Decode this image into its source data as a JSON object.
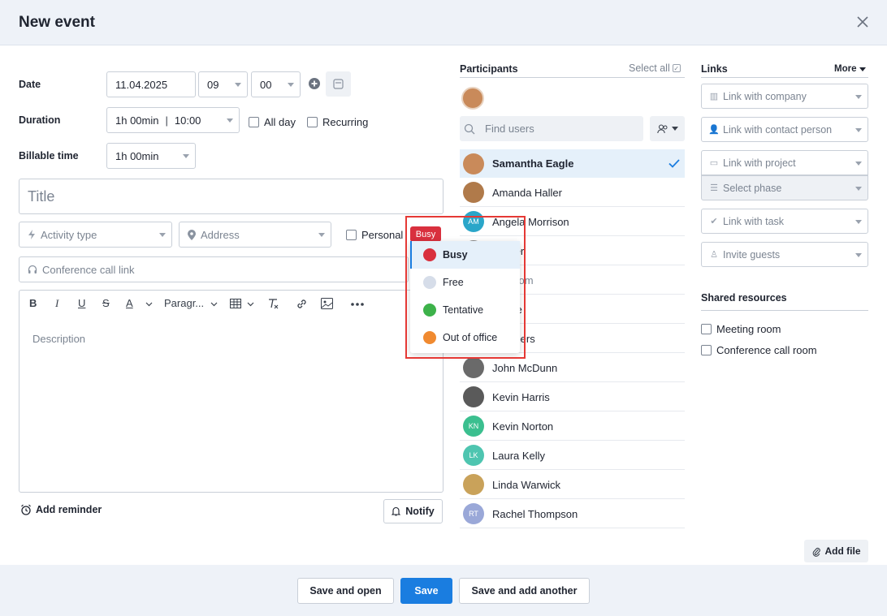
{
  "header": {
    "title": "New event"
  },
  "form": {
    "date_label": "Date",
    "date_value": "11.04.2025",
    "hour_value": "09",
    "minute_value": "00",
    "duration_label": "Duration",
    "duration_value": "1h 00min",
    "duration_end": "10:00",
    "all_day_label": "All day",
    "recurring_label": "Recurring",
    "billable_label": "Billable time",
    "billable_value": "1h 00min",
    "title_placeholder": "Title",
    "activity_type_placeholder": "Activity type",
    "address_placeholder": "Address",
    "personal_label": "Personal",
    "busy_badge": "Busy",
    "conference_placeholder": "Conference call link",
    "paragraph_label": "Paragr...",
    "description_placeholder": "Description",
    "add_reminder_label": "Add reminder",
    "notify_label": "Notify"
  },
  "availability_dropdown": {
    "items": [
      {
        "label": "Busy",
        "color": "#d9303e",
        "selected": true
      },
      {
        "label": "Free",
        "color": "#d6dde9",
        "selected": false
      },
      {
        "label": "Tentative",
        "color": "#3db24a",
        "selected": false
      },
      {
        "label": "Out of office",
        "color": "#f08a30",
        "selected": false
      }
    ]
  },
  "participants": {
    "title": "Participants",
    "select_all_label": "Select all",
    "search_placeholder": "Find users",
    "list": [
      {
        "name": "Samantha Eagle",
        "initials": "",
        "color": "#c98a5a",
        "selected": true
      },
      {
        "name": "Amanda Haller",
        "initials": "",
        "color": "#b07a4a",
        "selected": false
      },
      {
        "name": "Angela Morrison",
        "initials": "AM",
        "color": "#2aa6c9",
        "selected": false
      },
      {
        "name": "Tucker",
        "initials": "",
        "color": "#8a8a8a",
        "selected": false
      },
      {
        "name": "id Bloom",
        "initials": "",
        "color": "#b0b6c0",
        "selected": false
      },
      {
        "name": "Moore",
        "initials": "",
        "color": "#8a8a8a",
        "selected": false
      },
      {
        "name": "Numbers",
        "initials": "",
        "color": "#8a8a8a",
        "selected": false
      },
      {
        "name": "John McDunn",
        "initials": "",
        "color": "#6a6a6a",
        "selected": false
      },
      {
        "name": "Kevin Harris",
        "initials": "",
        "color": "#5a5a5a",
        "selected": false
      },
      {
        "name": "Kevin Norton",
        "initials": "KN",
        "color": "#3bbf8f",
        "selected": false
      },
      {
        "name": "Laura Kelly",
        "initials": "LK",
        "color": "#4ec5b0",
        "selected": false
      },
      {
        "name": "Linda Warwick",
        "initials": "",
        "color": "#c9a25a",
        "selected": false
      },
      {
        "name": "Rachel Thompson",
        "initials": "RT",
        "color": "#9aa8d8",
        "selected": false
      }
    ]
  },
  "links": {
    "title": "Links",
    "more_label": "More",
    "items": [
      {
        "label": "Link with company",
        "icon": "building-icon"
      },
      {
        "label": "Link with contact person",
        "icon": "person-icon"
      },
      {
        "label": "Link with project",
        "icon": "folder-icon"
      },
      {
        "label": "Select phase",
        "icon": "list-icon"
      },
      {
        "label": "Link with task",
        "icon": "check-icon"
      },
      {
        "label": "Invite guests",
        "icon": "guest-icon"
      }
    ],
    "shared_title": "Shared resources",
    "resources": [
      "Meeting room",
      "Conference call room"
    ],
    "add_file_label": "Add file"
  },
  "footer": {
    "save_open_label": "Save and open",
    "save_label": "Save",
    "save_another_label": "Save and add another"
  }
}
